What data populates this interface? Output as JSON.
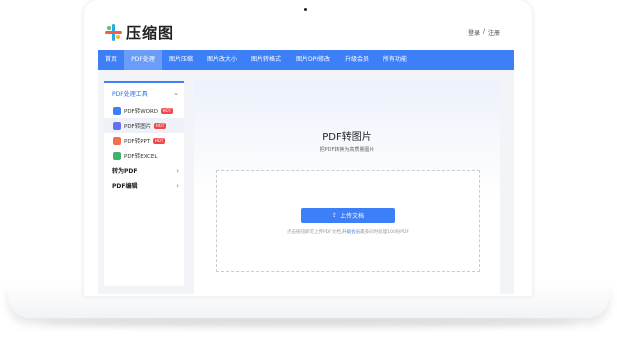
{
  "brand": {
    "name": "压缩图"
  },
  "auth": {
    "login": "登录",
    "separator": "/",
    "register": "注册"
  },
  "nav": {
    "items": [
      {
        "label": "首页"
      },
      {
        "label": "PDF处理"
      },
      {
        "label": "图片压缩"
      },
      {
        "label": "图片改大小"
      },
      {
        "label": "图片转格式"
      },
      {
        "label": "图片DPI修改"
      },
      {
        "label": "升级会员"
      },
      {
        "label": "所有功能"
      }
    ],
    "active_index": 1
  },
  "sidebar": {
    "section_title": "PDF处理工具",
    "tools": [
      {
        "label": "PDF转WORD",
        "badge": "HOT",
        "icon": "word-icon",
        "color": "#3d7ff7"
      },
      {
        "label": "PDF转图片",
        "badge": "HOT",
        "icon": "image-icon",
        "color": "#6a6ff2"
      },
      {
        "label": "PDF转PPT",
        "badge": "HOT",
        "icon": "ppt-icon",
        "color": "#f2704e"
      },
      {
        "label": "PDF转EXCEL",
        "badge": "",
        "icon": "excel-icon",
        "color": "#3fb26b"
      }
    ],
    "active_tool_index": 1,
    "groups": [
      {
        "label": "转为PDF"
      },
      {
        "label": "PDF编辑"
      }
    ]
  },
  "main": {
    "title": "PDF转图片",
    "subtitle": "把PDF转换为高质量图片",
    "upload_label": "上传文档",
    "hint_prefix": "点击按钮即可上传PDF文档,",
    "hint_link": "升级会员",
    "hint_suffix": "最多同时处理100份PDF"
  }
}
